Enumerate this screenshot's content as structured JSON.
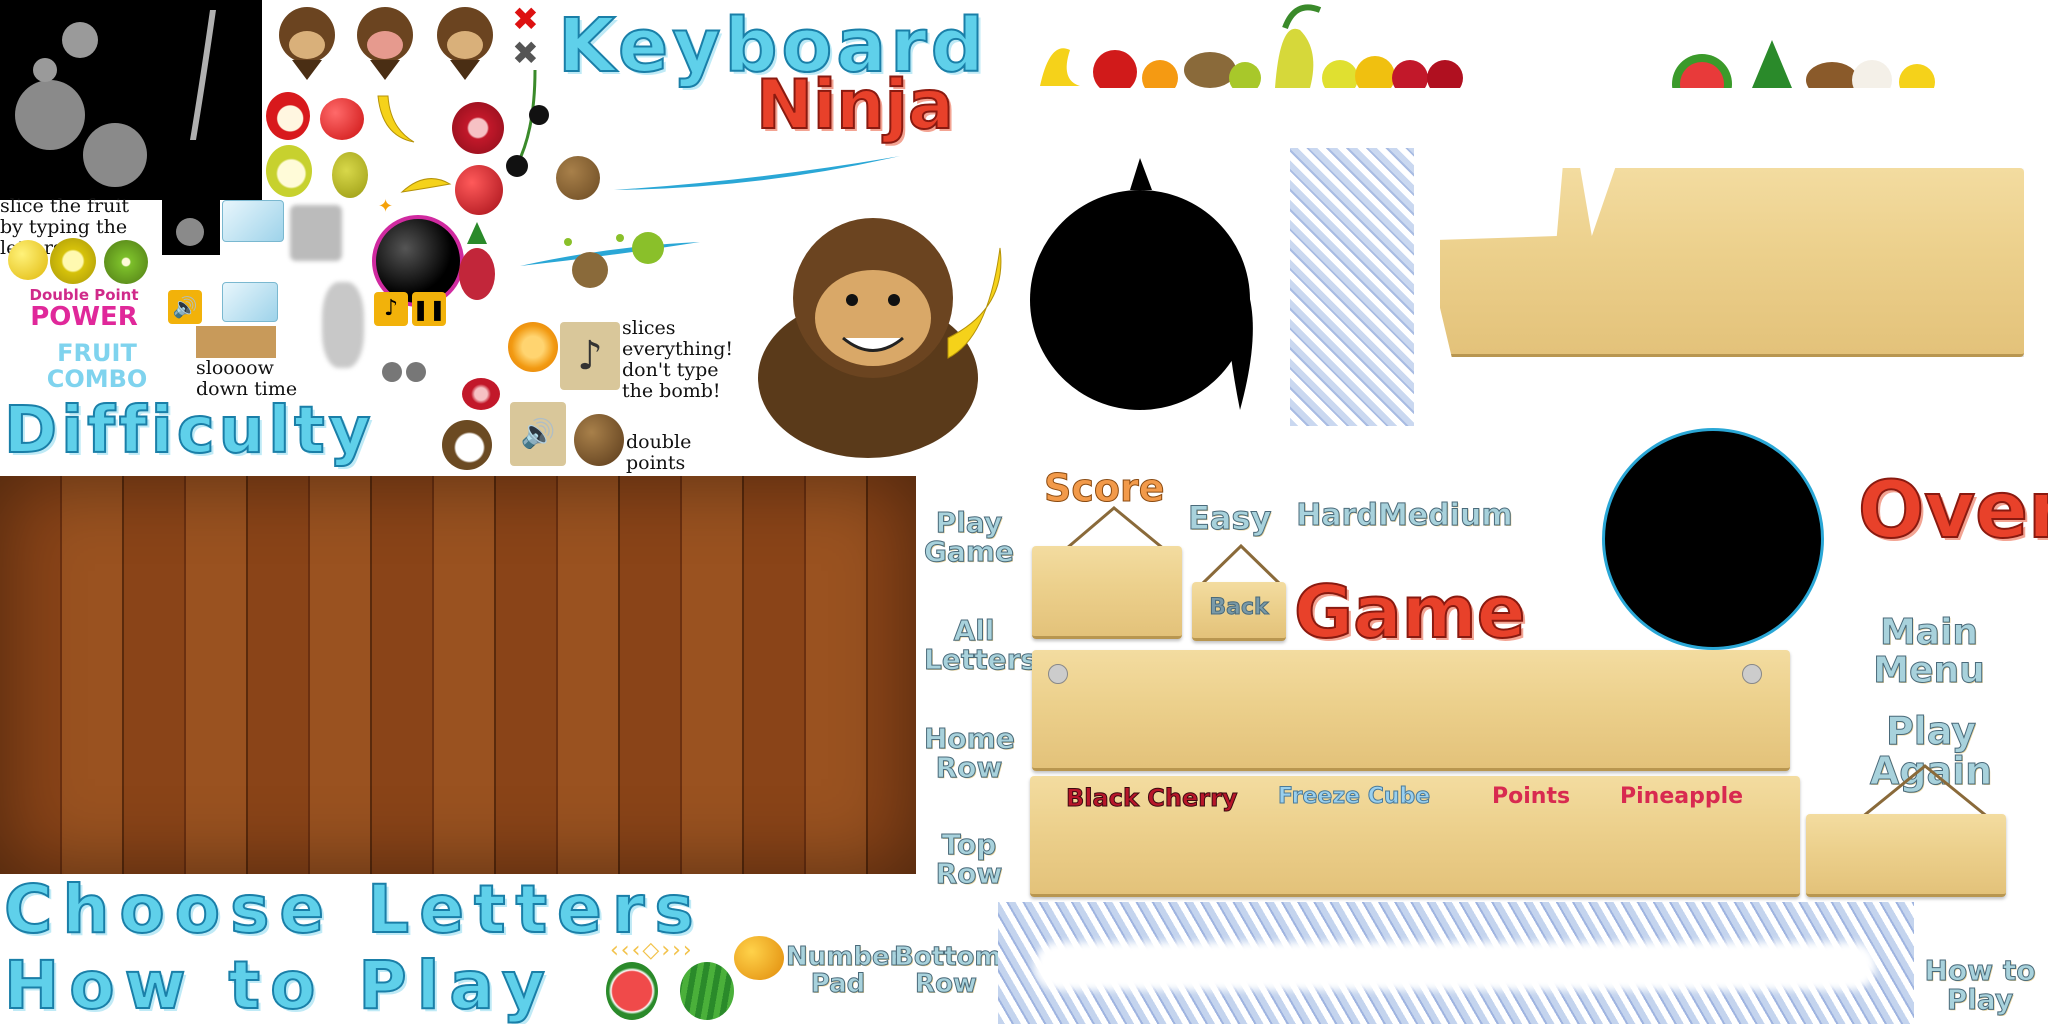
{
  "game": {
    "title_line1": "Keyboard",
    "title_line2": "Ninja"
  },
  "tips": {
    "slice": "slice the fruit by typing the letters",
    "slow": "sloooow down time",
    "bomb": "slices everything! don't type the bomb!",
    "double": "double points power!"
  },
  "powerups": {
    "double_line1": "Double Point",
    "double_line2": "POWER",
    "combo_line1": "FRUIT",
    "combo_line2": "COMBO"
  },
  "headings": {
    "difficulty": "Difficulty",
    "choose_letters": "Choose Letters",
    "how_to_play": "How to Play",
    "score": "Score",
    "game": "Game",
    "over": "Over"
  },
  "buttons": {
    "play_game": "Play Game",
    "all_letters": "All Letters",
    "home_row": "Home Row",
    "top_row": "Top Row",
    "number_pad": "Number Pad",
    "bottom_row": "Bottom Row",
    "easy": "Easy",
    "hard": "Hard",
    "medium": "Medium",
    "back": "Back",
    "main_menu": "Main Menu",
    "play_again": "Play Again",
    "how_to_play": "How to Play"
  },
  "labels": {
    "black_cherry": "Black Cherry",
    "freeze_cube": "Freeze Cube",
    "points": "Points",
    "pineapple": "Pineapple"
  },
  "colors": {
    "ice": "#5fd0ea",
    "red_title": "#e8412a",
    "wood_dark": "#7a3a14",
    "plank": "#ecd08c"
  }
}
